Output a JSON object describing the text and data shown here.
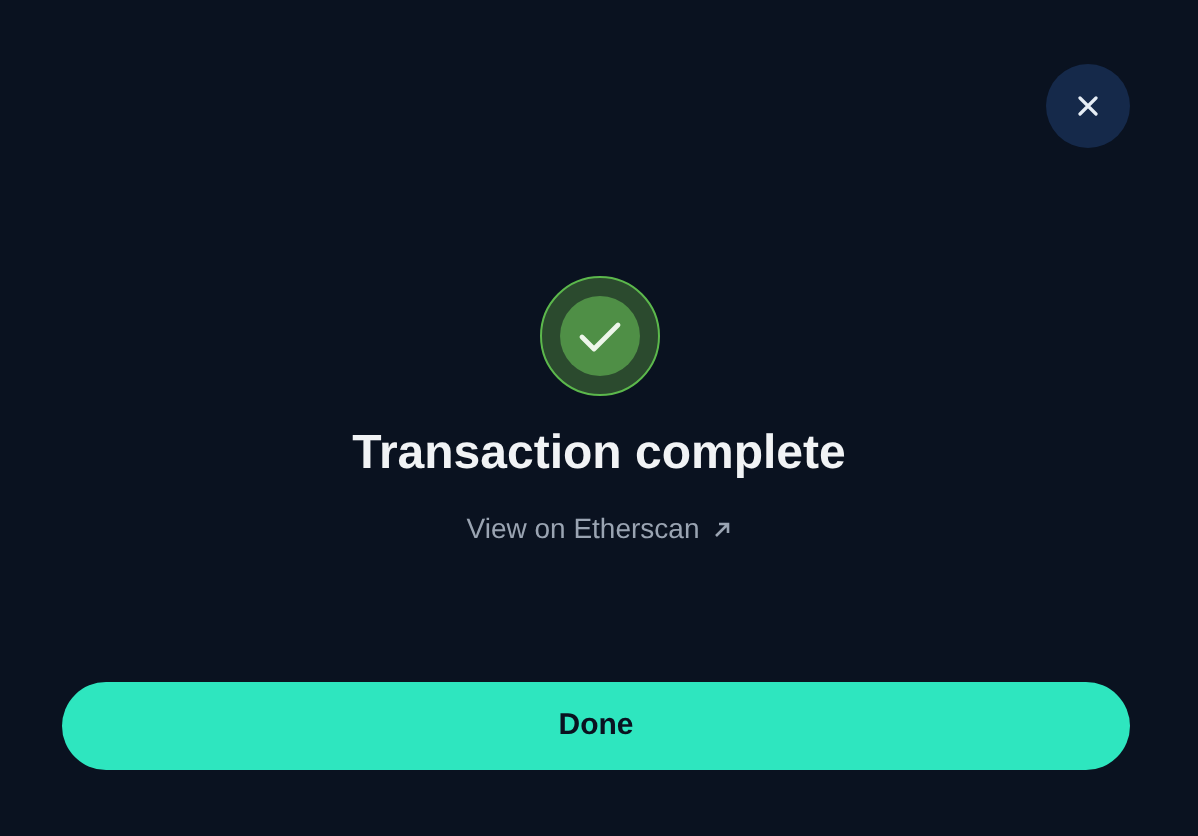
{
  "dialog": {
    "title": "Transaction complete",
    "link": "View on Etherscan",
    "button": "Done"
  }
}
